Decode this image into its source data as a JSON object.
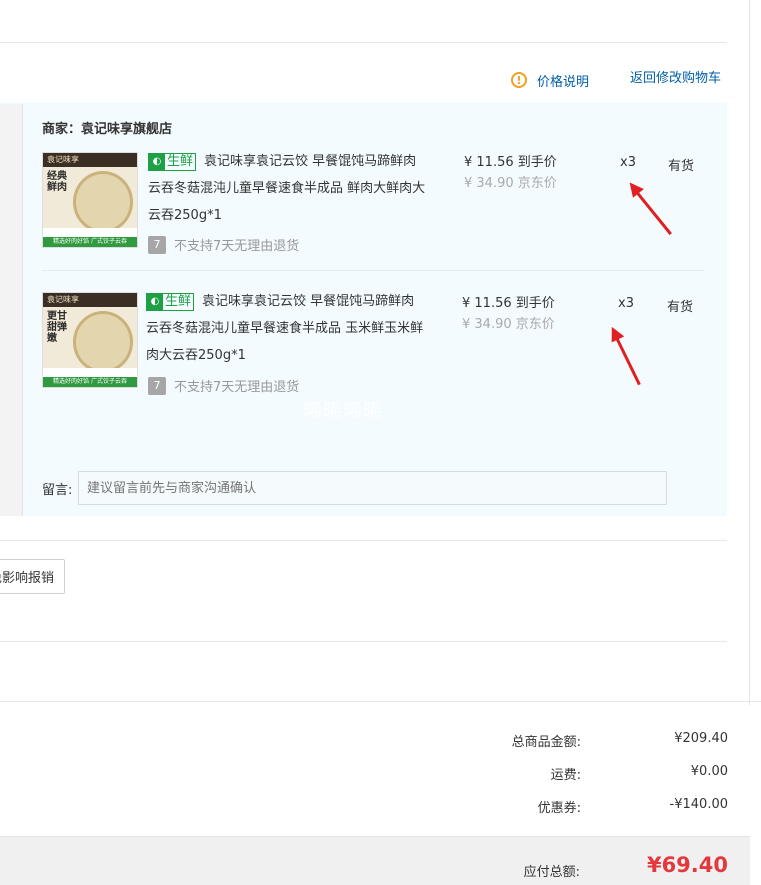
{
  "top": {
    "price_note": "价格说明",
    "back_to_cart": "返回修改购物车"
  },
  "seller": {
    "label": "商家：袁记味享旗舰店"
  },
  "items": [
    {
      "thumb_brand": "袁记味享",
      "thumb_slogan": "经典鲜肉",
      "thumb_footer": "精选好肉好馅 广式饺子云吞",
      "fresh_tag": "生鲜",
      "title": "袁记味享袁记云饺 早餐馄饨马蹄鲜肉云吞冬菇混沌儿童早餐速食半成品 鲜肉大鲜肉大云吞250g*1",
      "price": "¥ 11.56 到手价",
      "original_price": "¥ 34.90 京东价",
      "qty": "x3",
      "stock": "有货",
      "return_policy": "不支持7天无理由退货",
      "seven_label": "7"
    },
    {
      "thumb_brand": "袁记味享",
      "thumb_slogan": "更甘甜弹嫩",
      "thumb_footer": "精选好肉好馅 广式饺子云吞",
      "fresh_tag": "生鲜",
      "title": "袁记味享袁记云饺 早餐馄饨马蹄鲜肉云吞冬菇混沌儿童早餐速食半成品 玉米鲜玉米鲜肉大云吞250g*1",
      "price": "¥ 11.56 到手价",
      "original_price": "¥ 34.90 京东价",
      "qty": "x3",
      "stock": "有货",
      "return_policy": "不支持7天无理由退货",
      "seven_label": "7"
    }
  ],
  "watermark": "晞晞晞晞",
  "message": {
    "label": "留言:",
    "placeholder": "建议留言前先与商家沟通确认"
  },
  "invoice": {
    "button_label": "免影响报销"
  },
  "summary": {
    "goods_label": "总商品金额:",
    "goods_value": "¥209.40",
    "shipping_label": "运费:",
    "shipping_value": "¥0.00",
    "coupon_label": "优惠券:",
    "coupon_value": "-¥140.00",
    "payable_label": "应付总额:",
    "payable_value": "¥69.40"
  },
  "colors": {
    "link": "#005ea7",
    "fresh": "#1ea045",
    "payable": "#e4393c",
    "panel": "#f3fbfe",
    "annotation_arrow": "#e02020"
  }
}
